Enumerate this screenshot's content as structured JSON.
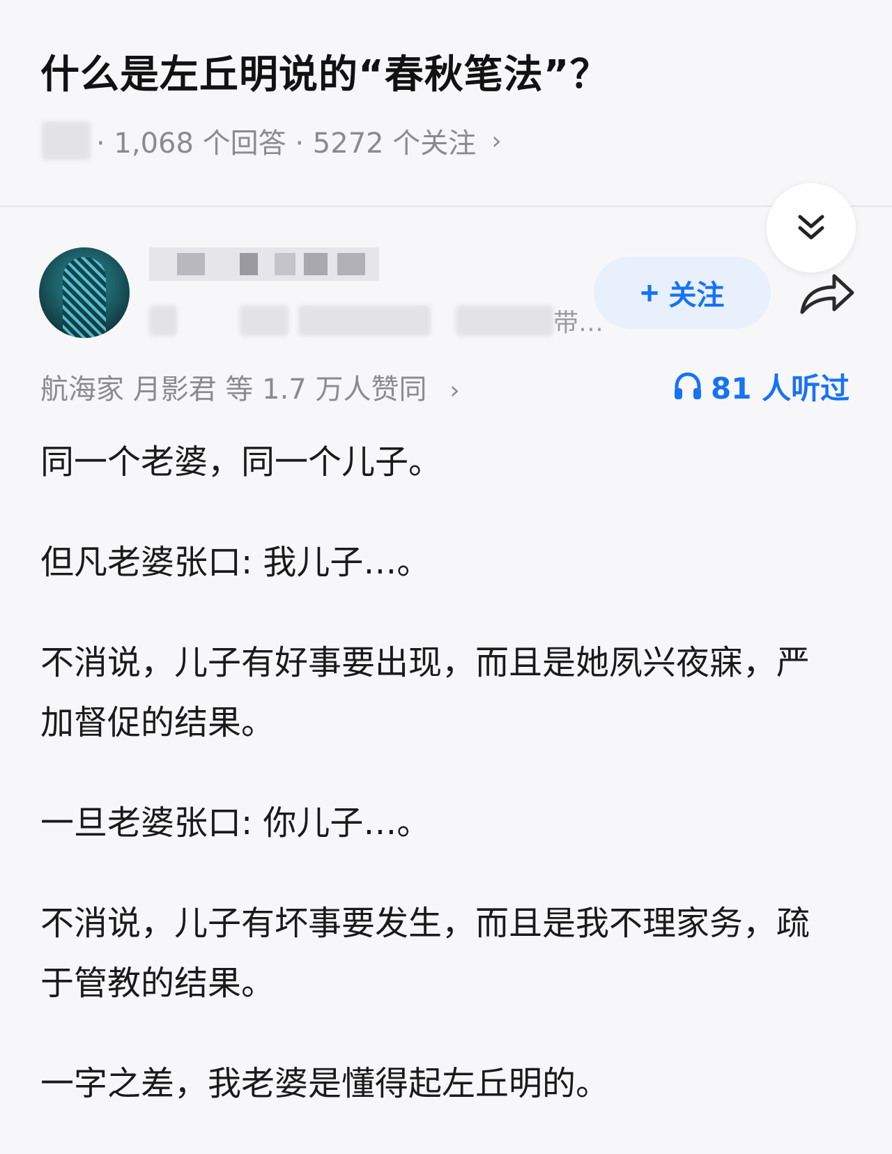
{
  "question": {
    "title": "什么是左丘明说的“春秋笔法”？",
    "meta": "· 1,068 个回答 · 5272 个关注",
    "meta_chevron": "›"
  },
  "collapse_button": {
    "icon": "double-chevron-down-icon"
  },
  "author": {
    "bio_tail": "带…",
    "follow_label": "关注",
    "follow_plus": "+",
    "share_icon": "share-icon"
  },
  "stats": {
    "likes_text": "航海家 月影君 等 1.7 万人赞同",
    "likes_chevron": "›",
    "listen_text": "81 人听过",
    "accent_color": "#1772f6"
  },
  "answer": {
    "paragraphs": [
      "同一个老婆，同一个儿子。",
      "但凡老婆张口: 我儿子…。",
      "不消说，儿子有好事要出现，而且是她夙兴夜寐，严加督促的结果。",
      "一旦老婆张口: 你儿子…。",
      "不消说，儿子有坏事要发生，而且是我不理家务，疏于管教的结果。",
      "一字之差，我老婆是懂得起左丘明的。"
    ]
  }
}
